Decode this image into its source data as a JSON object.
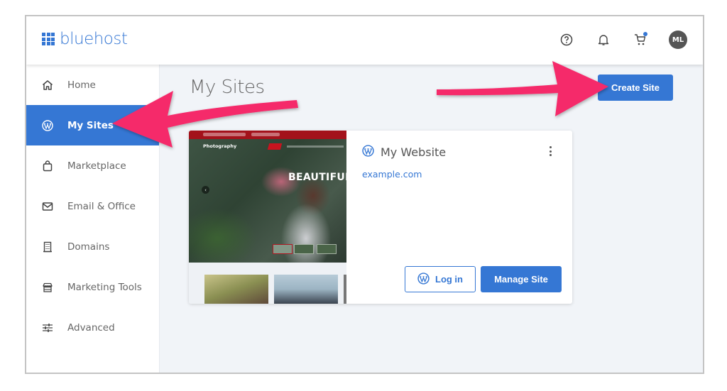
{
  "header": {
    "brand": "bluehost",
    "icons": [
      "help-icon",
      "bell-icon",
      "cart-icon"
    ],
    "cart_has_notification": true,
    "avatar_initials": "ML"
  },
  "sidebar": {
    "items": [
      {
        "label": "Home",
        "icon": "home-icon",
        "active": false
      },
      {
        "label": "My Sites",
        "icon": "wordpress-icon",
        "active": true
      },
      {
        "label": "Marketplace",
        "icon": "shopping-bag-icon",
        "active": false
      },
      {
        "label": "Email & Office",
        "icon": "envelope-icon",
        "active": false
      },
      {
        "label": "Domains",
        "icon": "building-icon",
        "active": false
      },
      {
        "label": "Marketing Tools",
        "icon": "storefront-icon",
        "active": false
      },
      {
        "label": "Advanced",
        "icon": "sliders-icon",
        "active": false
      }
    ]
  },
  "main": {
    "page_title": "My Sites",
    "create_button": "Create Site",
    "site": {
      "name": "My Website",
      "url": "example.com",
      "thumbnail": {
        "brand": "Photography",
        "headline": "BEAUTIFUL"
      },
      "login_button": "Log in",
      "manage_button": "Manage Site"
    }
  },
  "colors": {
    "accent": "#3577d4",
    "annotation_arrow": "#f5296a",
    "background": "#f1f4f8"
  }
}
